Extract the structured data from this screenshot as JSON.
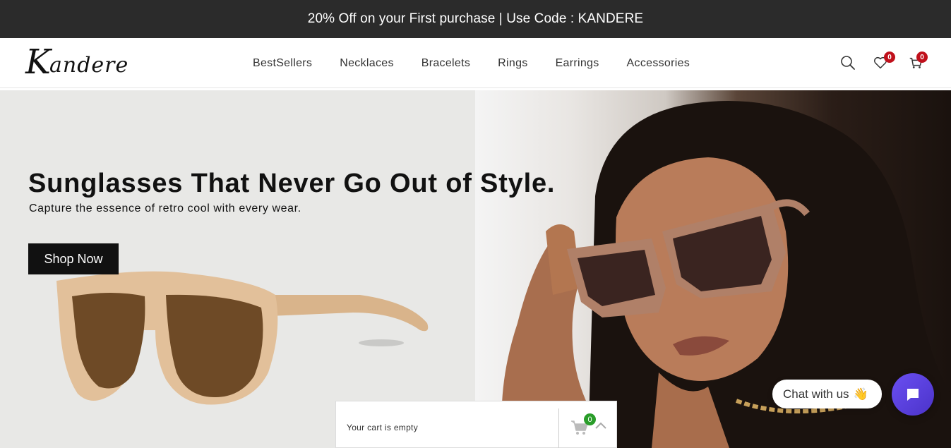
{
  "announcement": {
    "text": "20% Off on your First purchase | Use Code : KANDERE"
  },
  "header": {
    "logo_initial": "K",
    "logo_rest": "andere",
    "nav": [
      "BestSellers",
      "Necklaces",
      "Bracelets",
      "Rings",
      "Earrings",
      "Accessories"
    ],
    "icons": [
      "search-icon",
      "heart-icon",
      "cart-icon"
    ],
    "wishlist_count": "0",
    "cart_count": "0"
  },
  "hero": {
    "title": "Sunglasses That Never Go Out of Style.",
    "subtitle": "Capture the essence of retro cool with every wear.",
    "cta_label": "Shop Now"
  },
  "cart_bar": {
    "text": "Your cart is empty",
    "count": "0"
  },
  "chat": {
    "label": "Chat with us",
    "emoji": "👋"
  },
  "colors": {
    "announcement_bg": "#2b2b2b",
    "badge": "#c0101b",
    "chat_accent": "#5b3fe0",
    "cart_badge": "#2a9d2a"
  }
}
